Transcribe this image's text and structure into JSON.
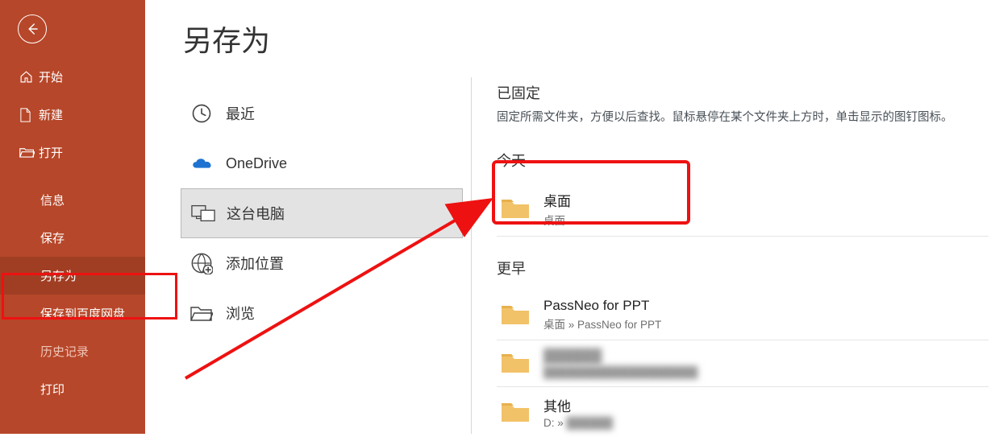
{
  "sidebar": {
    "items": [
      {
        "label": "开始"
      },
      {
        "label": "新建"
      },
      {
        "label": "打开"
      }
    ],
    "subs": [
      {
        "label": "信息"
      },
      {
        "label": "保存"
      },
      {
        "label": "另存为"
      },
      {
        "label": "保存到百度网盘"
      },
      {
        "label": "历史记录"
      },
      {
        "label": "打印"
      }
    ]
  },
  "page": {
    "title": "另存为"
  },
  "locations": [
    {
      "label": "最近"
    },
    {
      "label": "OneDrive"
    },
    {
      "label": "这台电脑"
    },
    {
      "label": "添加位置"
    },
    {
      "label": "浏览"
    }
  ],
  "right": {
    "pinned": {
      "head": "已固定",
      "desc": "固定所需文件夹，方便以后查找。鼠标悬停在某个文件夹上方时，单击显示的图钉图标。"
    },
    "today": {
      "head": "今天"
    },
    "older": {
      "head": "更早"
    },
    "folders": {
      "desktop": {
        "name": "桌面",
        "path": "桌面"
      },
      "passneo": {
        "name": "PassNeo for PPT",
        "path": "桌面 » PassNeo for PPT"
      },
      "redacted": {
        "name": "██████",
        "path": "████████████████████"
      },
      "other": {
        "name": "其他",
        "path": "D: » ██████"
      }
    }
  }
}
